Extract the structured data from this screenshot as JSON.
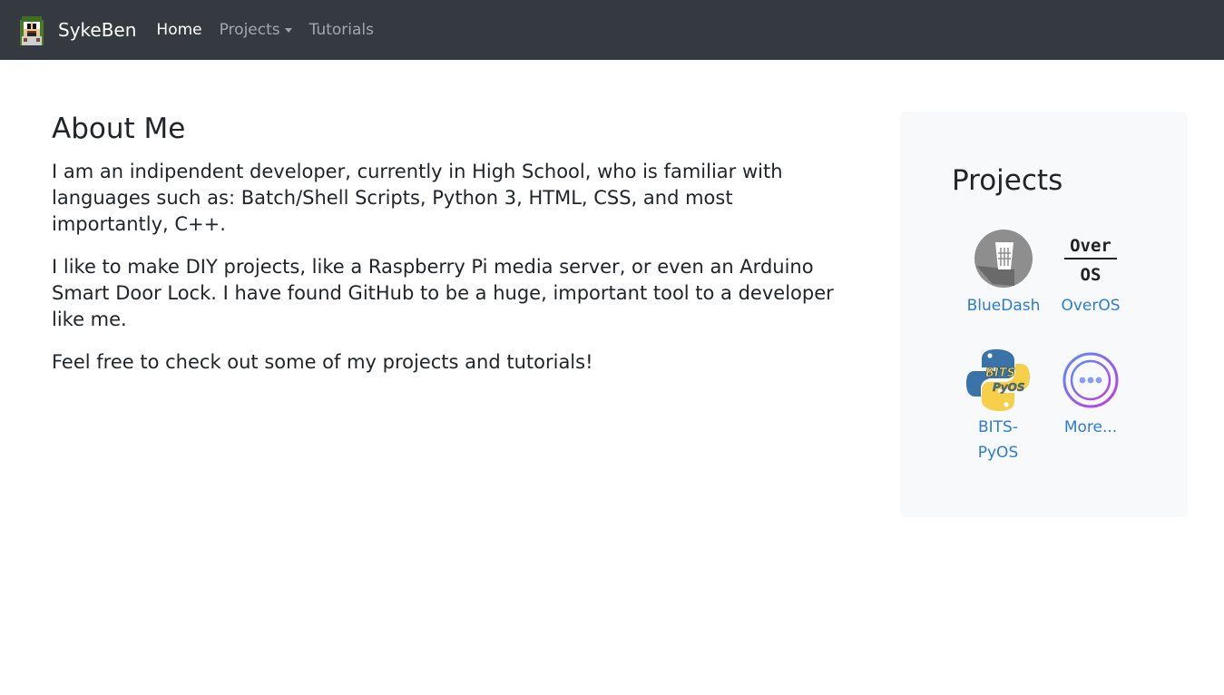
{
  "navbar": {
    "brand": "SykeBen",
    "links": [
      {
        "label": "Home",
        "active": true
      },
      {
        "label": "Projects",
        "dropdown": true
      },
      {
        "label": "Tutorials"
      }
    ]
  },
  "about": {
    "title": "About Me",
    "paragraphs": [
      "I am an indipendent developer, currently in High School, who is familiar with languages such as: Batch/Shell Scripts, Python 3, HTML, CSS, and most importantly, C++.",
      "I like to make DIY projects, like a Raspberry Pi media server, or even an Arduino Smart Door Lock. I have found GitHub to be a huge, important tool to a developer like me.",
      "Feel free to check out some of my projects and tutorials!"
    ]
  },
  "sidebar": {
    "title": "Projects",
    "projects": [
      {
        "label": "BlueDash",
        "icon": "bluedash-logo-icon"
      },
      {
        "label": "OverOS",
        "icon": "overos-logo-icon",
        "logo_text_top": "Over",
        "logo_text_bottom": "OS"
      },
      {
        "label": "BITS-PyOS",
        "label_line1": "BITS-",
        "label_line2": "PyOS",
        "icon": "bits-pyos-logo-icon",
        "logo_text_top": "BITS",
        "logo_text_bottom": "PyOS"
      },
      {
        "label": "More...",
        "icon": "more-ellipsis-icon"
      }
    ]
  },
  "colors": {
    "navbar_bg": "#343a40",
    "link": "#2b7bd6",
    "sidebar_bg": "#f8f9fa"
  }
}
